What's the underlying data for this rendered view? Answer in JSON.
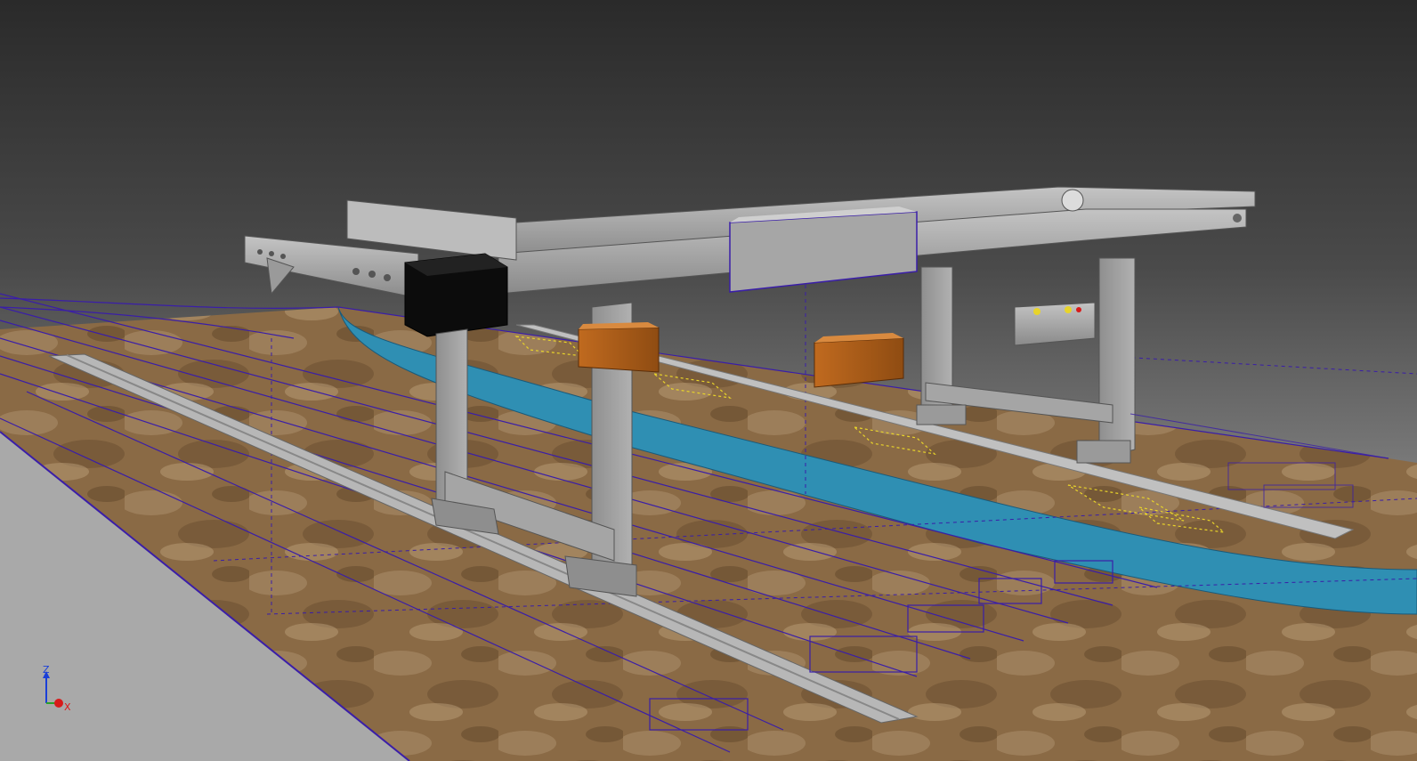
{
  "viewport": {
    "background_top": "#2b2b2b",
    "background_bottom": "#b8b8b8",
    "sketch_line_color": "#3a1ea8",
    "water_color": "#2f8fb3",
    "steel_color": "#9a9a9a",
    "container_color": "#b8651e"
  },
  "axis_triad": {
    "z_label": "Z",
    "x_label": "X",
    "z_color": "#1a3fd8",
    "x_color": "#d81a1a",
    "y_color": "#2aa02a"
  }
}
